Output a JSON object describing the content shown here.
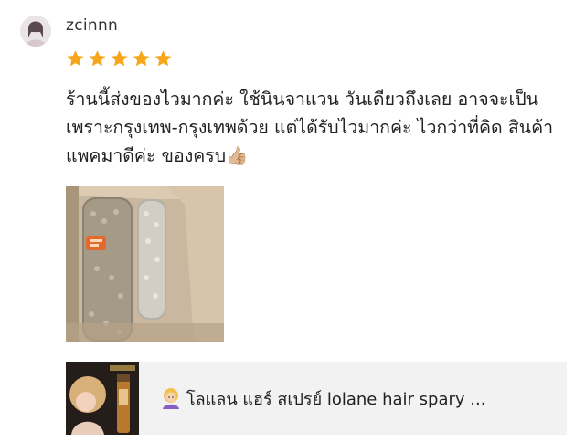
{
  "review": {
    "username": "zcinnn",
    "rating": 5,
    "max_rating": 5,
    "star_color": "#f6a51c",
    "text": "ร้านนี้ส่งของไวมากค่ะ ใช้นินจาแวน วันเดียวถึงเลย อาจจะเป็นเพราะกรุงเทพ-กรุงเทพด้วย แต่ได้รับไวมากค่ะ ไวกว่าที่คิด สินค้าแพคมาดีค่ะ ของครบ👍🏼",
    "photo_icon": "package-photo"
  },
  "product": {
    "emoji_icon": "person-blonde-icon",
    "title": "โลแลน แฮร์ สเปรย์ lolane hair spary ...",
    "thumb_icon": "product-thumbnail"
  },
  "colors": {
    "card_bg": "#f2f2f2",
    "text": "#222222",
    "username": "#333333"
  }
}
